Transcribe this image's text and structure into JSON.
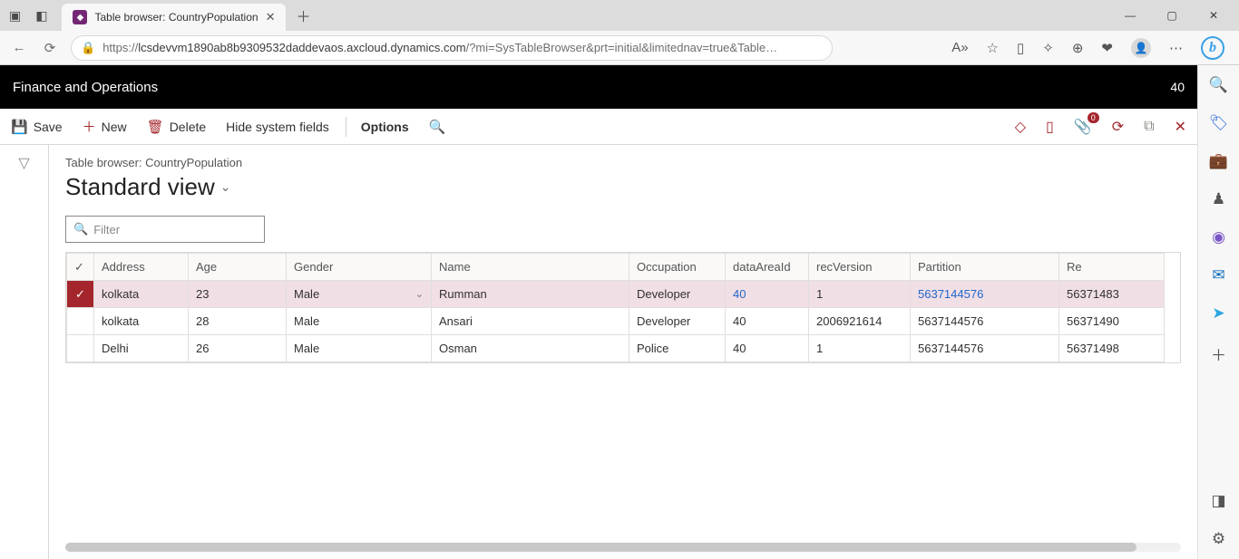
{
  "browser": {
    "tab_title": "Table browser: CountryPopulation",
    "url_host": "lcsdevvm1890ab8b9309532daddevaos.axcloud.dynamics.com",
    "url_path": "/?mi=SysTableBrowser&prt=initial&limitednav=true&Table…",
    "reader_label": "A»"
  },
  "app": {
    "title": "Finance and Operations",
    "company": "40"
  },
  "actionbar": {
    "save": "Save",
    "new": "New",
    "delete": "Delete",
    "hide_system_fields": "Hide system fields",
    "options": "Options",
    "notif_badge": "0"
  },
  "page": {
    "breadcrumb": "Table browser: CountryPopulation",
    "view_title": "Standard view",
    "filter_placeholder": "Filter"
  },
  "grid": {
    "headers": {
      "address": "Address",
      "age": "Age",
      "gender": "Gender",
      "name": "Name",
      "occupation": "Occupation",
      "dataAreaId": "dataAreaId",
      "recVersion": "recVersion",
      "partition": "Partition",
      "recId": "Re"
    },
    "rows": [
      {
        "selected": true,
        "address": "kolkata",
        "age": "23",
        "gender": "Male",
        "name": "Rumman",
        "occupation": "Developer",
        "dataAreaId": "40",
        "recVersion": "1",
        "partition": "5637144576",
        "recId": "56371483"
      },
      {
        "selected": false,
        "address": "kolkata",
        "age": "28",
        "gender": "Male",
        "name": "Ansari",
        "occupation": "Developer",
        "dataAreaId": "40",
        "recVersion": "2006921614",
        "partition": "5637144576",
        "recId": "56371490"
      },
      {
        "selected": false,
        "address": "Delhi",
        "age": "26",
        "gender": "Male",
        "name": "Osman",
        "occupation": "Police",
        "dataAreaId": "40",
        "recVersion": "1",
        "partition": "5637144576",
        "recId": "56371498"
      }
    ]
  }
}
